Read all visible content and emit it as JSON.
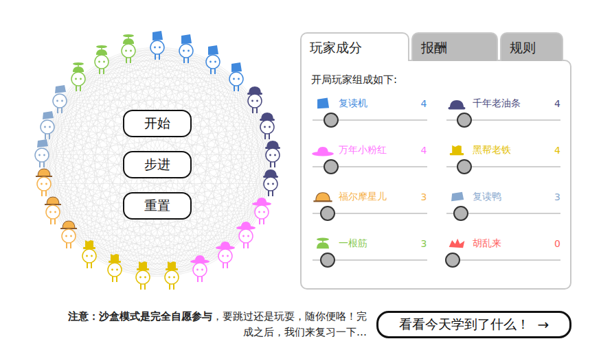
{
  "circle_buttons": [
    {
      "label": "开始"
    },
    {
      "label": "步进"
    },
    {
      "label": "重置"
    }
  ],
  "tabs": [
    {
      "label": "玩家成分",
      "selected": true
    },
    {
      "label": "报酬",
      "selected": false
    },
    {
      "label": "规则",
      "selected": false
    }
  ],
  "composition": {
    "heading": "开局玩家组成如下:",
    "strategies": [
      {
        "name": "复读机",
        "count": "4",
        "level": 0.16,
        "color": "#4089dd",
        "kind": "bucket"
      },
      {
        "name": "千年老油条",
        "count": "4",
        "level": 0.16,
        "color": "#4b4b80",
        "kind": "bowler"
      },
      {
        "name": "万年小粉红",
        "count": "4",
        "level": 0.16,
        "color": "#ff75ff",
        "kind": "sunhat"
      },
      {
        "name": "黑帮老铁",
        "count": "4",
        "level": 0.16,
        "color": "#e3c000",
        "kind": "tophat"
      },
      {
        "name": "福尔摩星儿",
        "count": "3",
        "level": 0.13,
        "color": "#f6b24c",
        "kind": "deerstalker"
      },
      {
        "name": "复读鸭",
        "count": "3",
        "level": 0.13,
        "color": "#88a8ce",
        "kind": "duckcap"
      },
      {
        "name": "一根筋",
        "count": "3",
        "level": 0.13,
        "color": "#88c94f",
        "kind": "propeller"
      },
      {
        "name": "胡乱来",
        "count": "0",
        "level": 0.06,
        "color": "#ff5e5e",
        "kind": "messy"
      }
    ]
  },
  "note": {
    "bold": "注意：沙盒模式是完全自愿参与",
    "text": "，要跳过还是玩耍，随你便咯！完成之后，我们来复习一下…"
  },
  "next_button": {
    "label": "看看今天学到了什么！",
    "arrow": "→"
  }
}
